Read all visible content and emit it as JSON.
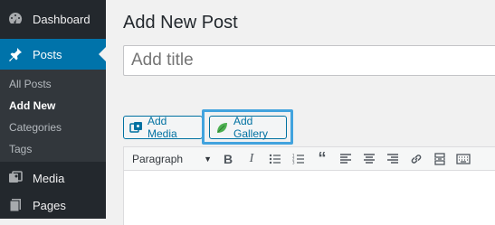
{
  "sidebar": {
    "items": [
      {
        "label": "Dashboard",
        "icon": "dashboard-icon"
      },
      {
        "label": "Posts",
        "icon": "pushpin-icon",
        "active": true
      },
      {
        "label": "Media",
        "icon": "media-icon"
      },
      {
        "label": "Pages",
        "icon": "pages-icon"
      }
    ],
    "submenu": [
      {
        "label": "All Posts"
      },
      {
        "label": "Add New",
        "current": true
      },
      {
        "label": "Categories"
      },
      {
        "label": "Tags"
      }
    ]
  },
  "main": {
    "page_title": "Add New Post",
    "title_placeholder": "Add title",
    "add_media_label": "Add Media",
    "add_gallery_label": "Add Gallery",
    "format_select": "Paragraph",
    "toolbar_buttons": [
      "bold",
      "italic",
      "bullet-list",
      "numbered-list",
      "blockquote",
      "align-left",
      "align-center",
      "align-right",
      "link",
      "read-more",
      "toolbar-toggle"
    ]
  },
  "colors": {
    "sidebar_bg": "#23282d",
    "active_bg": "#0073aa",
    "highlight": "#42a3de",
    "gallery_leaf": "#4caf50"
  }
}
